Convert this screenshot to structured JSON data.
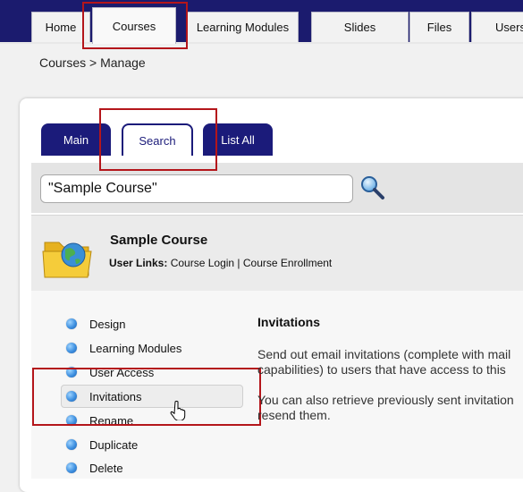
{
  "nav": {
    "tabs": [
      {
        "label": "Home"
      },
      {
        "label": "Courses"
      },
      {
        "label": "Learning Modules"
      },
      {
        "label": "Slides"
      },
      {
        "label": "Files"
      },
      {
        "label": "Users"
      }
    ]
  },
  "breadcrumb": "Courses > Manage",
  "subtabs": [
    {
      "label": "Main"
    },
    {
      "label": "Search"
    },
    {
      "label": "List All"
    }
  ],
  "search": {
    "value": "\"Sample Course\"",
    "icon": "magnifier-icon"
  },
  "course": {
    "title": "Sample Course",
    "user_links_label": "User Links:",
    "links": [
      "Course Login",
      "Course Enrollment"
    ],
    "separator": " | ",
    "icon": "globe-folder-icon"
  },
  "menu": [
    {
      "label": "Design"
    },
    {
      "label": "Learning Modules"
    },
    {
      "label": "User Access"
    },
    {
      "label": "Invitations"
    },
    {
      "label": "Rename"
    },
    {
      "label": "Duplicate"
    },
    {
      "label": "Delete"
    }
  ],
  "detail": {
    "title": "Invitations",
    "lines": [
      "Send out email invitations (complete with mail",
      "capabilities) to users that have access to this",
      "You can also retrieve previously sent invitation",
      "resend them."
    ]
  },
  "colors": {
    "nav": "#1b1b6e",
    "tab_active": "#1b1b7a",
    "highlight": "#b4161b"
  }
}
